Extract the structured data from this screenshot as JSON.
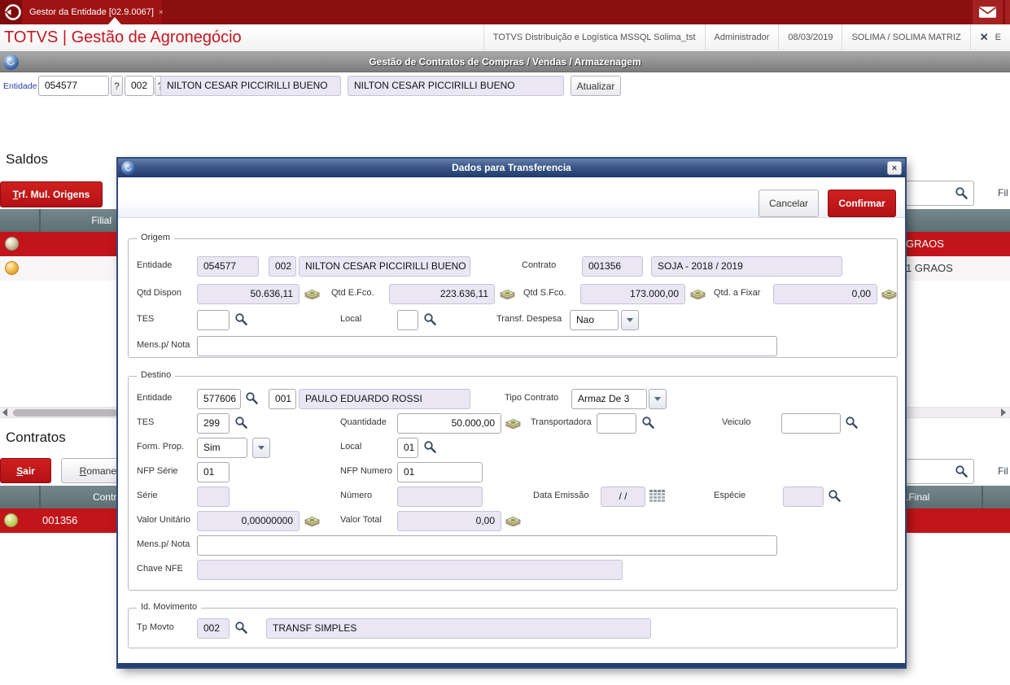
{
  "topbar": {
    "tab_title": "Gestor da Entidade [02.9.0067]",
    "tab_close": "×"
  },
  "appbar": {
    "brand": "TOTVS | Gestão de Agronegócio",
    "environment": "TOTVS Distribuição e Logística MSSQL Solima_tst",
    "user": "Administrador",
    "date": "08/03/2019",
    "company": "SOLIMA / SOLIMA MATRIZ",
    "exit_label": "E"
  },
  "toolbar": {
    "title": "Gestão de Contratos de Compras / Vendas / Armazenagem"
  },
  "entity_bar": {
    "label": "Entidade",
    "code": "054577",
    "help1": "?",
    "store": "002",
    "help2": "?",
    "name": "NILTON CESAR PICCIRILLI BUENO",
    "name_confirm": "NILTON CESAR PICCIRILLI BUENO",
    "refresh_button": "Atualizar"
  },
  "saldos": {
    "title": "Saldos",
    "multi_origin_button": "Trf. Mul. Origens",
    "filter_label": "Fil",
    "header_filial": "Filial",
    "rows": [
      {
        "right_text": "GRAOS"
      },
      {
        "right_text": "1 GRAOS"
      }
    ]
  },
  "contratos": {
    "title": "Contratos",
    "exit_button": "Sair",
    "romaneio_button": "Romaneio",
    "filter_label": "Fil",
    "header_contrato": "Contrato",
    "header_final": ".Final",
    "rows": [
      {
        "contrato": "001356"
      }
    ]
  },
  "dialog": {
    "title": "Dados para Transferencia",
    "close": "×",
    "cancel_button": "Cancelar",
    "confirm_button": "Confirmar",
    "origem": {
      "legend": "Origem",
      "entidade_label": "Entidade",
      "entidade_cod": "054577",
      "entidade_loja": "002",
      "entidade_nome": "NILTON CESAR PICCIRILLI BUENO",
      "contrato_label": "Contrato",
      "contrato_cod": "001356",
      "contrato_desc": "SOJA  - 2018 / 2019",
      "qtd_dispon_label": "Qtd Dispon",
      "qtd_dispon": "50.636,11",
      "qtd_efco_label": "Qtd E.Fco.",
      "qtd_efco": "223.636,11",
      "qtd_sfco_label": "Qtd S.Fco.",
      "qtd_sfco": "173.000,00",
      "qtd_fixar_label": "Qtd. a Fixar",
      "qtd_fixar": "0,00",
      "tes_label": "TES",
      "tes": "",
      "local_label": "Local",
      "local": "",
      "transf_despesa_label": "Transf. Despesa",
      "transf_despesa": "Nao",
      "mens_label": "Mens.p/ Nota",
      "mens": ""
    },
    "destino": {
      "legend": "Destino",
      "entidade_label": "Entidade",
      "entidade_cod": "577606",
      "loja": "001",
      "nome": "PAULO EDUARDO ROSSI",
      "tipo_contrato_label": "Tipo Contrato",
      "tipo_contrato": "Armaz De 3",
      "tes_label": "TES",
      "tes": "299",
      "quantidade_label": "Quantidade",
      "quantidade": "50.000,00",
      "transportadora_label": "Transportadora",
      "transportadora": "",
      "veiculo_label": "Veiculo",
      "veiculo": "",
      "form_prop_label": "Form. Prop.",
      "form_prop": "Sim",
      "local_label": "Local",
      "local": "01",
      "nfp_serie_label": "NFP Série",
      "nfp_serie": "01",
      "nfp_numero_label": "NFP Numero",
      "nfp_numero": "01",
      "serie_label": "Série",
      "serie": "",
      "numero_label": "Número",
      "numero": "",
      "data_emissao_label": "Data Emissão",
      "data_emissao": "/ /",
      "especie_label": "Espécie",
      "especie": "",
      "valor_unitario_label": "Valor Unitário",
      "valor_unitario": "0,00000000",
      "valor_total_label": "Valor Total",
      "valor_total": "0,00",
      "mens_label": "Mens.p/ Nota",
      "mens": "",
      "chave_label": "Chave NFE",
      "chave": ""
    },
    "movimento": {
      "legend": "Id. Movimento",
      "tp_movto_label": "Tp Movto",
      "tp_movto": "002",
      "tp_movto_desc": "TRANSF SIMPLES"
    }
  }
}
